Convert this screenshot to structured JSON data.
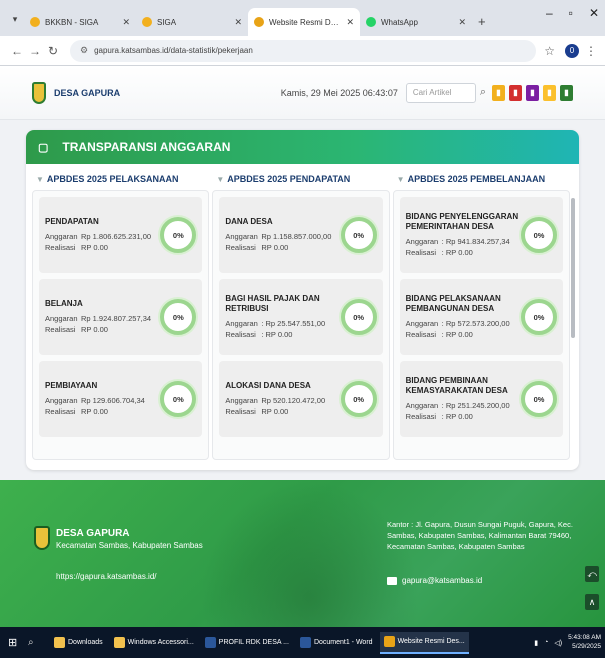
{
  "browser": {
    "tabs": [
      {
        "title": "BKKBN - SIGA",
        "favicon_color": "#f2b01e",
        "active": false
      },
      {
        "title": "SIGA",
        "favicon_color": "#f2b01e",
        "active": false
      },
      {
        "title": "Website Resmi Desa Gapura Kec",
        "favicon_color": "#e8a317",
        "active": true
      },
      {
        "title": "WhatsApp",
        "favicon_color": "#25d366",
        "active": false
      }
    ],
    "url": "gapura.katsambas.id/data-statistik/pekerjaan",
    "profile_initial": "0"
  },
  "header": {
    "site_name": "DESA GAPURA",
    "datetime": "Kamis, 29 Mei 2025  06:43:07",
    "search_placeholder": "Cari Artikel",
    "icon_colors": [
      "#f2b01e",
      "#d32f2f",
      "#7b1fa2",
      "#fbc02d",
      "#2e7d32"
    ]
  },
  "panel": {
    "title": "TRANSPARANSI ANGGARAN",
    "columns": [
      {
        "title": "APBDES 2025 PELAKSANAAN",
        "cards": [
          {
            "name": "PENDAPATAN",
            "anggaran": "Rp 1.806.625.231,00",
            "realisasi": "RP 0.00",
            "percent": "0%"
          },
          {
            "name": "BELANJA",
            "anggaran": "Rp 1.924.807.257,34",
            "realisasi": "RP 0.00",
            "percent": "0%"
          },
          {
            "name": "PEMBIAYAAN",
            "anggaran": "Rp 129.606.704,34",
            "realisasi": "RP 0.00",
            "percent": "0%"
          }
        ]
      },
      {
        "title": "APBDES 2025 PENDAPATAN",
        "cards": [
          {
            "name": "DANA DESA",
            "anggaran": "Rp 1.158.857.000,00",
            "realisasi": "RP 0.00",
            "percent": "0%"
          },
          {
            "name": "BAGI HASIL PAJAK DAN RETRIBUSI",
            "anggaran": ": Rp 25.547.551,00",
            "realisasi": ": RP 0.00",
            "percent": "0%"
          },
          {
            "name": "ALOKASI DANA DESA",
            "anggaran": "Rp 520.120.472,00",
            "realisasi": "RP 0.00",
            "percent": "0%"
          }
        ]
      },
      {
        "title": "APBDES 2025 PEMBELANJAAN",
        "cards": [
          {
            "name": "BIDANG PENYELENGGARAN PEMERINTAHAN DESA",
            "anggaran": ": Rp 941.834.257,34",
            "realisasi": ": RP 0.00",
            "percent": "0%"
          },
          {
            "name": "BIDANG PELAKSANAAN PEMBANGUNAN DESA",
            "anggaran": ": Rp 572.573.200,00",
            "realisasi": ": RP 0.00",
            "percent": "0%"
          },
          {
            "name": "BIDANG PEMBINAAN KEMASYARAKATAN DESA",
            "anggaran": ": Rp 251.245.200,00",
            "realisasi": ": RP 0.00",
            "percent": "0%"
          }
        ]
      }
    ],
    "anggaran_label": "Anggaran",
    "realisasi_label": "Realisasi"
  },
  "footer": {
    "name": "DESA GAPURA",
    "subtitle": "Kecamatan Sambas, Kabupaten Sambas",
    "url": "https://gapura.katsambas.id/",
    "address": "Kantor : Jl. Gapura, Dusun Sungai Puguk, Gapura, Kec. Sambas, Kabupaten Sambas, Kalimantan Barat 79460, Kecamatan Sambas, Kabupaten Sambas",
    "email": "gapura@katsambas.id"
  },
  "taskbar": {
    "items": [
      {
        "label": "Downloads",
        "color": "#f2c14e",
        "active": false
      },
      {
        "label": "Windows Accessori...",
        "color": "#f2c14e",
        "active": false
      },
      {
        "label": "PROFIL RDK DESA ...",
        "color": "#2b579a",
        "active": false
      },
      {
        "label": "Document1 - Word",
        "color": "#2b579a",
        "active": false
      },
      {
        "label": "Website Resmi Des...",
        "color": "#e8a317",
        "active": true
      }
    ],
    "time": "5:43:08 AM",
    "date": "5/29/2025"
  }
}
